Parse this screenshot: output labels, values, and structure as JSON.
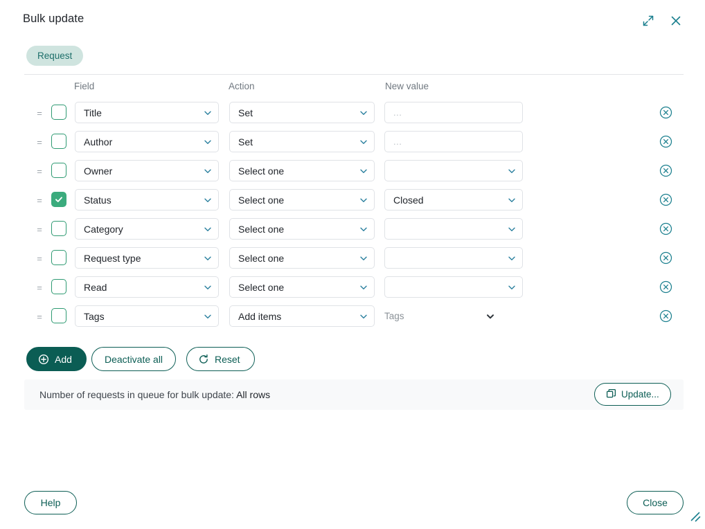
{
  "window": {
    "title": "Bulk update",
    "expand_icon": "expand-diagonal-icon",
    "close_icon": "close-icon",
    "accent_color": "#0b5d54",
    "icon_color": "#1a7f8e",
    "checkbox_checked_color": "#3bab7d"
  },
  "entity_chip": {
    "label": "Request",
    "background": "#cfe4df",
    "text_color": "#1d6f6a"
  },
  "columns": {
    "field": "Field",
    "action": "Action",
    "new_value": "New value"
  },
  "rows": [
    {
      "field": "Title",
      "action": "Set",
      "value": "",
      "placeholder": "...",
      "value_type": "text",
      "checked": false
    },
    {
      "field": "Author",
      "action": "Set",
      "value": "",
      "placeholder": "...",
      "value_type": "text",
      "checked": false
    },
    {
      "field": "Owner",
      "action": "Select one",
      "value": "",
      "placeholder": "",
      "value_type": "select",
      "checked": false
    },
    {
      "field": "Status",
      "action": "Select one",
      "value": "Closed",
      "placeholder": "",
      "value_type": "select",
      "checked": true
    },
    {
      "field": "Category",
      "action": "Select one",
      "value": "",
      "placeholder": "",
      "value_type": "select",
      "checked": false
    },
    {
      "field": "Request type",
      "action": "Select one",
      "value": "",
      "placeholder": "",
      "value_type": "select",
      "checked": false
    },
    {
      "field": "Read",
      "action": "Select one",
      "value": "",
      "placeholder": "",
      "value_type": "select",
      "checked": false
    },
    {
      "field": "Tags",
      "action": "Add items",
      "value": "Tags",
      "placeholder": "",
      "value_type": "bare",
      "checked": false
    }
  ],
  "row_delete_icon": "remove-circle-icon",
  "drag_handle_icon": "drag-handle-icon",
  "toolbar": {
    "add_label": "Add",
    "add_icon": "plus-circle-icon",
    "deactivate_label": "Deactivate all",
    "reset_label": "Reset",
    "reset_icon": "refresh-icon"
  },
  "status": {
    "label": "Number of requests in queue for bulk update:",
    "value": "All rows",
    "update_label": "Update...",
    "update_icon": "copy-icon"
  },
  "footer": {
    "help_label": "Help",
    "close_label": "Close",
    "resize_icon": "resize-grip-icon"
  }
}
